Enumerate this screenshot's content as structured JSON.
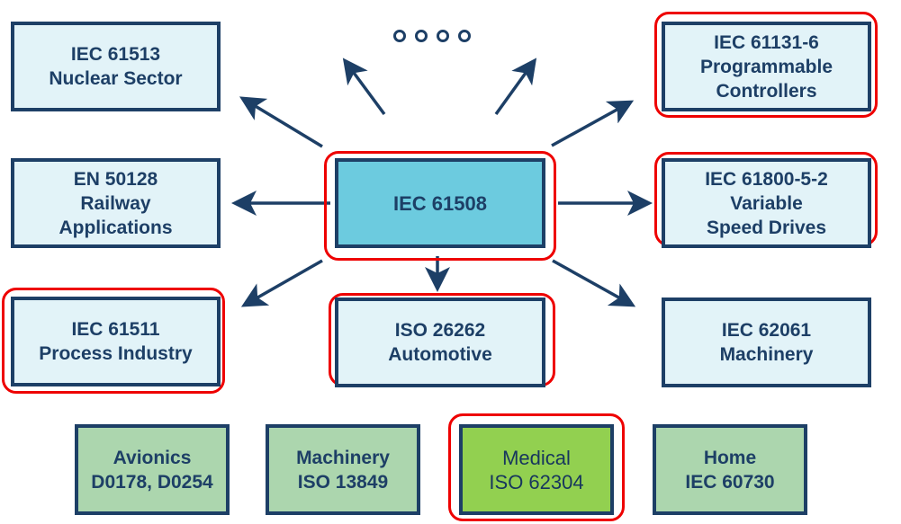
{
  "diagram": {
    "center": {
      "line1": "IEC 61508"
    },
    "derived_standards": [
      {
        "id": "nuclear",
        "line1": "IEC 61513",
        "line2": "Nuclear Sector",
        "highlighted": false
      },
      {
        "id": "programmable",
        "line1": "IEC 61131-6",
        "line2": "Programmable",
        "line3": "Controllers",
        "highlighted": true
      },
      {
        "id": "railway",
        "line1": "EN 50128",
        "line2": "Railway",
        "line3": "Applications",
        "highlighted": false
      },
      {
        "id": "drives",
        "line1": "IEC 61800-5-2",
        "line2": "Variable",
        "line3": "Speed Drives",
        "highlighted": true
      },
      {
        "id": "process",
        "line1": "IEC 61511",
        "line2": "Process Industry",
        "highlighted": true
      },
      {
        "id": "automotive",
        "line1": "ISO 26262",
        "line2": "Automotive",
        "highlighted": true
      },
      {
        "id": "machinery62061",
        "line1": "IEC 62061",
        "line2": "Machinery",
        "highlighted": false
      }
    ],
    "other_standards": [
      {
        "id": "avionics",
        "line1": "Avionics",
        "line2": "D0178, D0254",
        "highlighted": false
      },
      {
        "id": "machinery13849",
        "line1": "Machinery",
        "line2": "ISO 13849",
        "highlighted": false
      },
      {
        "id": "medical",
        "line1": "Medical",
        "line2": "ISO 62304",
        "highlighted": true
      },
      {
        "id": "home",
        "line1": "Home",
        "line2": "IEC 60730",
        "highlighted": false
      }
    ],
    "ellipsis_marker": "more-standards",
    "colors": {
      "border": "#1d3f66",
      "highlight": "#ee0000",
      "center_fill": "#6ccbdf",
      "light_fill": "#e2f3f8",
      "green_fill": "#acd6ae",
      "lime_fill": "#92d050"
    }
  }
}
